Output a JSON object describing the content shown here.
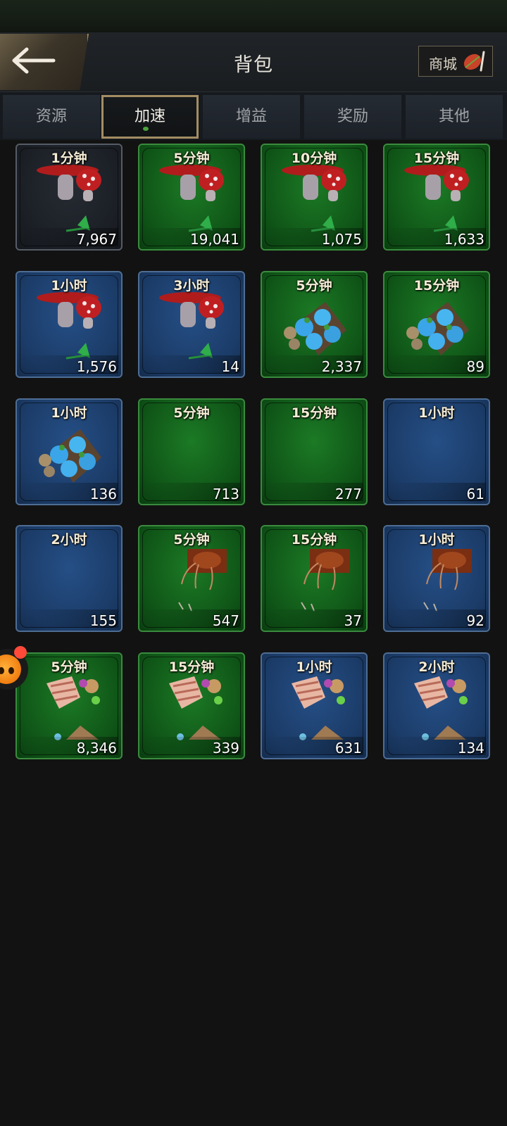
{
  "header": {
    "title": "背包",
    "shop_label": "商城"
  },
  "tabs": [
    {
      "label": "资源",
      "active": false
    },
    {
      "label": "加速",
      "active": true
    },
    {
      "label": "增益",
      "active": false
    },
    {
      "label": "奖励",
      "active": false
    },
    {
      "label": "其他",
      "active": false
    }
  ],
  "items": [
    {
      "label": "1分钟",
      "count": "7,967",
      "color": "gray",
      "icon": "mushroom-icon"
    },
    {
      "label": "5分钟",
      "count": "19,041",
      "color": "green",
      "icon": "mushroom-icon"
    },
    {
      "label": "10分钟",
      "count": "1,075",
      "color": "green",
      "icon": "mushroom-icon"
    },
    {
      "label": "15分钟",
      "count": "1,633",
      "color": "green",
      "icon": "mushroom-icon"
    },
    {
      "label": "1小时",
      "count": "1,576",
      "color": "blue",
      "icon": "mushroom-icon"
    },
    {
      "label": "3小时",
      "count": "14",
      "color": "blue",
      "icon": "mushroom-icon"
    },
    {
      "label": "5分钟",
      "count": "2,337",
      "color": "green",
      "icon": "egg-tray-icon"
    },
    {
      "label": "15分钟",
      "count": "89",
      "color": "green",
      "icon": "egg-tray-icon"
    },
    {
      "label": "1小时",
      "count": "136",
      "color": "blue",
      "icon": "egg-tray-icon"
    },
    {
      "label": "5分钟",
      "count": "713",
      "color": "green",
      "icon": "blank-icon"
    },
    {
      "label": "15分钟",
      "count": "277",
      "color": "green",
      "icon": "blank-icon"
    },
    {
      "label": "1小时",
      "count": "61",
      "color": "blue",
      "icon": "blank-icon"
    },
    {
      "label": "2小时",
      "count": "155",
      "color": "blue",
      "icon": "blank-icon"
    },
    {
      "label": "5分钟",
      "count": "547",
      "color": "green",
      "icon": "ant-icon"
    },
    {
      "label": "15分钟",
      "count": "37",
      "color": "green",
      "icon": "ant-icon"
    },
    {
      "label": "1小时",
      "count": "92",
      "color": "blue",
      "icon": "ant-icon"
    },
    {
      "label": "5分钟",
      "count": "8,346",
      "color": "green",
      "icon": "shell-icon"
    },
    {
      "label": "15分钟",
      "count": "339",
      "color": "green",
      "icon": "shell-icon"
    },
    {
      "label": "1小时",
      "count": "631",
      "color": "blue",
      "icon": "shell-icon"
    },
    {
      "label": "2小时",
      "count": "134",
      "color": "blue",
      "icon": "shell-icon"
    }
  ]
}
